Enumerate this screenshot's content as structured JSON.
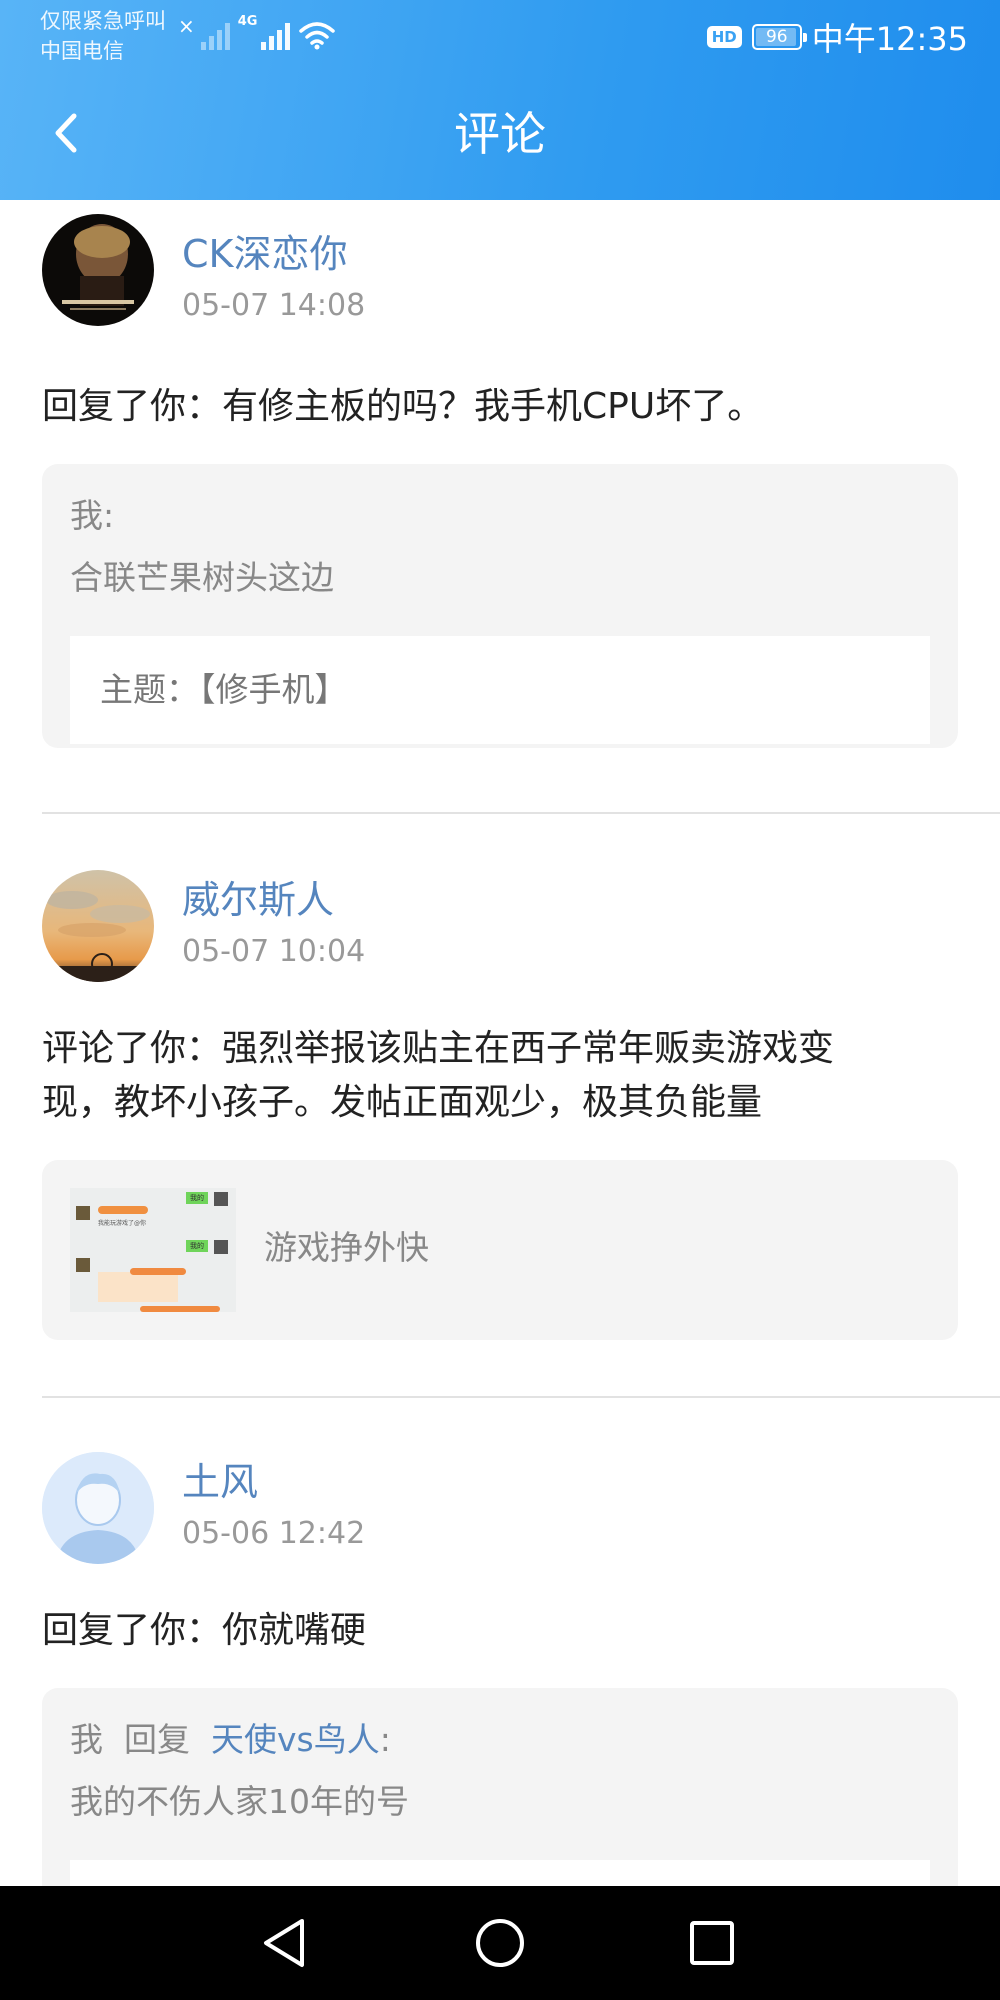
{
  "status_bar": {
    "carrier_line1": "仅限紧急呼叫",
    "carrier_line2": "中国电信",
    "signal_x": "×",
    "network": "4G",
    "hd": "HD",
    "battery": "96",
    "battery_level_percent": 96,
    "time": "中午12:35"
  },
  "header": {
    "title": "评论",
    "back_icon": "chevron-left-icon"
  },
  "items": [
    {
      "user": "CK深恋你",
      "time": "05-07 14:08",
      "text": "回复了你：有修主板的吗？我手机CPU坏了。",
      "quote": {
        "author": "我:",
        "content": "合联芒果树头这边",
        "topic": "主题：【修手机】"
      }
    },
    {
      "user": "威尔斯人",
      "time": "05-07 10:04",
      "text_line1": "评论了你：强烈举报该贴主在西子常年贩卖游戏变",
      "text_line2": "现，教坏小孩子。发帖正面观少，极其负能量",
      "quote": {
        "content": "游戏挣外快",
        "thumb_tag": "我的",
        "thumb_msg": "我能玩游戏了@你"
      }
    },
    {
      "user": "土风",
      "time": "05-06 12:42",
      "text": "回复了你：你就嘴硬",
      "quote": {
        "me": "我",
        "reply_word": "回复",
        "reply_to": "天使vs鸟人",
        "colon": ":",
        "content": "我的不伤人家10年的号"
      }
    }
  ],
  "nav": {
    "back": "triangle-back-icon",
    "home": "circle-home-icon",
    "recents": "square-recents-icon"
  },
  "colors": {
    "header_blue": "#2f9bf0",
    "username_blue": "#5585be"
  }
}
